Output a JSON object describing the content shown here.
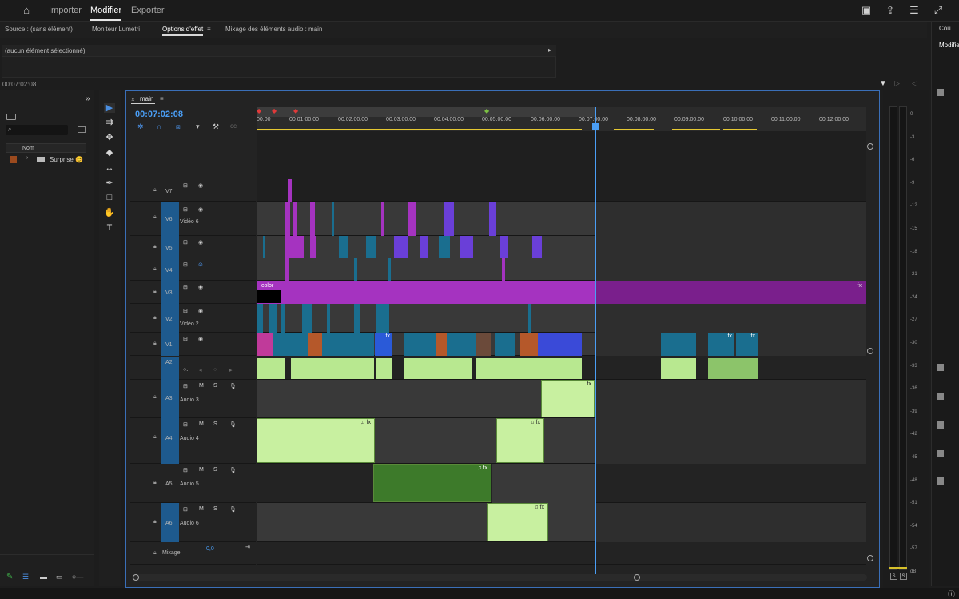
{
  "topnav": {
    "home_icon": "home-icon",
    "items": [
      "Importer",
      "Modifier",
      "Exporter"
    ],
    "active": "Modifier"
  },
  "panel_tabs": [
    "Source : (sans élément)",
    "Moniteur Lumetri",
    "Options d'effet",
    "Mixage des éléments audio : main"
  ],
  "effects": {
    "no_selection": "(aucun élément sélectionné)",
    "timecode": "00:07:02:08"
  },
  "project": {
    "column": "Nom",
    "item": "Surprise 😊"
  },
  "timeline": {
    "tab": "main",
    "timecode": "00:07:02:08",
    "ruler_ticks": [
      "00:00",
      "00:01:00:00",
      "00:02:00:00",
      "00:03:00:00",
      "00:04:00:00",
      "00:05:00:00",
      "00:06:00:00",
      "00:07:00:00",
      "00:08:00:00",
      "00:09:00:00",
      "00:10:00:00",
      "00:11:00:00",
      "00:12:00:00"
    ],
    "video_tracks": [
      {
        "id": "V7",
        "name": ""
      },
      {
        "id": "V6",
        "name": "Vidéo 6"
      },
      {
        "id": "V5",
        "name": ""
      },
      {
        "id": "V4",
        "name": ""
      },
      {
        "id": "V3",
        "name": ""
      },
      {
        "id": "V2",
        "name": "Vidéo 2"
      },
      {
        "id": "V1",
        "name": ""
      }
    ],
    "audio_tracks": [
      {
        "id": "A2",
        "name": ""
      },
      {
        "id": "A3",
        "name": "Audio 3"
      },
      {
        "id": "A4",
        "name": "Audio 4"
      },
      {
        "id": "A5",
        "name": "Audio 5"
      },
      {
        "id": "A6",
        "name": "Audio 6"
      }
    ],
    "mix_label": "Mixage",
    "mix_value": "0,0",
    "color_clip": "color",
    "btn_m": "M",
    "btn_s": "S"
  },
  "meters": {
    "scale": [
      "0",
      "-3",
      "-6",
      "-9",
      "-12",
      "-15",
      "-18",
      "-21",
      "-24",
      "-27",
      "-30",
      "-33",
      "-36",
      "-39",
      "-42",
      "-45",
      "-48",
      "-51",
      "-54",
      "-57",
      "dB"
    ],
    "solo": [
      "S",
      "S"
    ]
  },
  "right_panel": {
    "tab1": "Cou",
    "tab2": "Modifie"
  },
  "colors": {
    "accent_blue": "#3a7fd5",
    "clip_teal": "#1a6e8f",
    "clip_purple": "#a533c0",
    "clip_violet": "#6a3fd8",
    "audio_green": "#c8f0a0",
    "audio_dark_green": "#3d7a2a"
  }
}
